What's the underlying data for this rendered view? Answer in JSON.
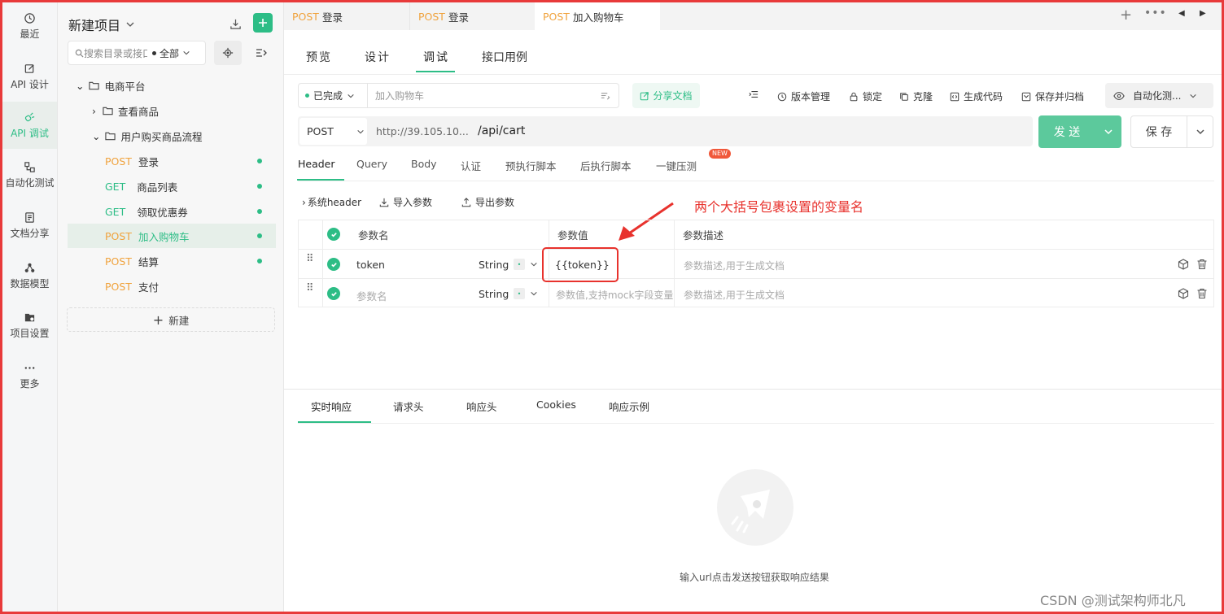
{
  "nav": {
    "items": [
      {
        "label": "最近",
        "icon": "clock-icon"
      },
      {
        "label": "API 设计",
        "icon": "edit-icon"
      },
      {
        "label": "API 调试",
        "icon": "debug-icon"
      },
      {
        "label": "自动化测试",
        "icon": "flow-icon"
      },
      {
        "label": "文档分享",
        "icon": "document-icon"
      },
      {
        "label": "数据模型",
        "icon": "model-icon"
      },
      {
        "label": "项目设置",
        "icon": "settings-folder-icon"
      },
      {
        "label": "更多",
        "icon": "more-icon"
      }
    ]
  },
  "sidebar": {
    "project_title": "新建项目",
    "search_placeholder": "搜索目录或接口",
    "filter_label": "全部",
    "tree": {
      "root": "电商平台",
      "folder1": "查看商品",
      "folder2": "用户购买商品流程",
      "items": [
        {
          "method": "POST",
          "name": "登录"
        },
        {
          "method": "GET",
          "name": "商品列表"
        },
        {
          "method": "GET",
          "name": "领取优惠券"
        },
        {
          "method": "POST",
          "name": "加入购物车"
        },
        {
          "method": "POST",
          "name": "结算"
        },
        {
          "method": "POST",
          "name": "支付"
        }
      ]
    },
    "new_label": "新建"
  },
  "tabs": [
    {
      "method": "POST",
      "name": "登录"
    },
    {
      "method": "POST",
      "name": "登录"
    },
    {
      "method": "POST",
      "name": "加入购物车"
    }
  ],
  "subtabs": [
    "预览",
    "设计",
    "调试",
    "接口用例"
  ],
  "toolbar": {
    "status": "已完成",
    "name_placeholder": "加入购物车",
    "share": "分享文档",
    "version": "版本管理",
    "lock": "锁定",
    "clone": "克隆",
    "gencode": "生成代码",
    "save_archive": "保存并归档",
    "env": "自动化测..."
  },
  "request": {
    "method": "POST",
    "base_url": "http://39.105.10...",
    "path": "/api/cart",
    "send": "发 送",
    "save": "保 存"
  },
  "param_tabs": [
    "Header",
    "Query",
    "Body",
    "认证",
    "预执行脚本",
    "后执行脚本",
    "一键压测"
  ],
  "new_badge": "NEW",
  "header_actions": {
    "system": "系统header",
    "import": "导入参数",
    "export": "导出参数"
  },
  "annotation": "两个大括号包裹设置的变量名",
  "table": {
    "headers": {
      "name": "参数名",
      "value": "参数值",
      "desc": "参数描述"
    },
    "rows": [
      {
        "name": "token",
        "type": "String",
        "value": "{{token}}",
        "desc": "参数描述,用于生成文档"
      },
      {
        "name": "参数名",
        "type": "String",
        "value": "参数值,支持mock字段变量",
        "desc": "参数描述,用于生成文档"
      }
    ]
  },
  "response_tabs": [
    "实时响应",
    "请求头",
    "响应头",
    "Cookies",
    "响应示例"
  ],
  "empty_text": "输入url点击发送按钮获取响应结果",
  "watermark": "CSDN @测试架构师北凡",
  "colors": {
    "accent": "#2dbd86",
    "post": "#f0a23c",
    "annotation": "#e8322d"
  }
}
